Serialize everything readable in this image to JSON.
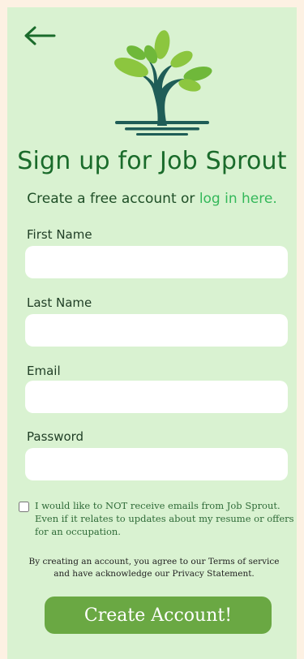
{
  "app": {
    "name": "Job Sprout"
  },
  "colors": {
    "brand_green": "#1a6b2b",
    "link_green": "#34b85a",
    "button_green": "#6aa843",
    "panel": "#d9f2d1"
  },
  "header": {
    "back_icon": "arrow-left-icon",
    "logo_icon": "tree-logo-icon"
  },
  "signup": {
    "title": "Sign up for Job Sprout",
    "subtitle_text": "Create a free account or ",
    "login_link": "log in here."
  },
  "form": {
    "first_name_label": "First Name",
    "first_name_value": "",
    "last_name_label": "Last Name",
    "last_name_value": "",
    "email_label": "Email",
    "email_value": "",
    "password_label": "Password",
    "password_value": "",
    "optout_checked": false,
    "optout_text": "I would like to NOT receive emails from Job Sprout. Even if it relates to updates about my resume or offers for an occupation.",
    "legal_text": "By creating an account, you agree to our Terms of service and have acknowledge our Privacy Statement.",
    "submit_label": "Create Account!"
  }
}
